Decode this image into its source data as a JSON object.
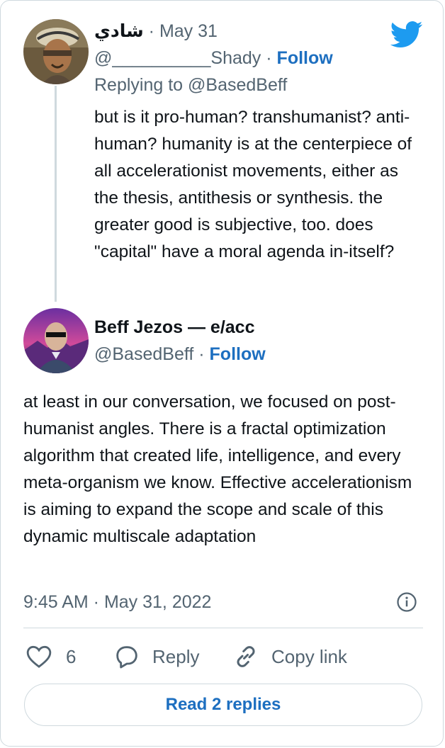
{
  "reply_tweet": {
    "display_name": "شادي",
    "date": "May 31",
    "handle": "@__________Shady",
    "follow_label": "Follow",
    "replying_to": "Replying to @BasedBeff",
    "text": "but is it pro-human? transhumanist? anti-human? humanity is at the centerpiece of all accelerationist movements, either as the thesis, antithesis or synthesis. the greater good is subjective, too. does \"capital\" have a moral agenda in-itself?"
  },
  "main_tweet": {
    "display_name": "Beff Jezos — e/acc",
    "handle": "@BasedBeff",
    "follow_label": "Follow",
    "text": "at least in our conversation, we focused on post-humanist angles. There is a fractal optimization algorithm that created life, intelligence, and every meta-organism we know. Effective accelerationism is aiming to expand the scope and scale of this dynamic multiscale adaptation",
    "timestamp": "9:45 AM · May 31, 2022"
  },
  "actions": {
    "like_count": "6",
    "reply_label": "Reply",
    "copy_link_label": "Copy link"
  },
  "read_replies_label": "Read 2 replies",
  "colors": {
    "accent": "#1d6fc0",
    "twitter_blue": "#1d9bf0",
    "muted": "#536471",
    "border": "#cfd9de"
  }
}
